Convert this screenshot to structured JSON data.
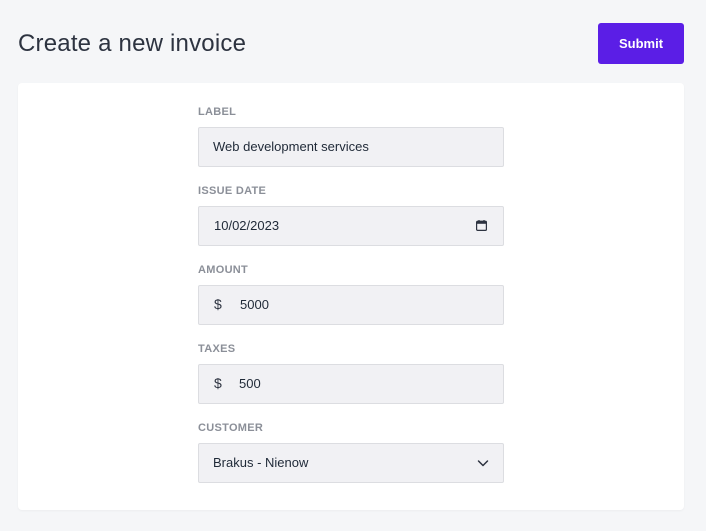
{
  "header": {
    "title": "Create a new invoice",
    "submit_label": "Submit"
  },
  "form": {
    "label": {
      "caption": "LABEL",
      "value": "Web development services"
    },
    "issue_date": {
      "caption": "ISSUE DATE",
      "value": "10/02/2023"
    },
    "amount": {
      "caption": "AMOUNT",
      "currency": "$",
      "value": "5000"
    },
    "taxes": {
      "caption": "TAXES",
      "currency": "$",
      "value": "500"
    },
    "customer": {
      "caption": "CUSTOMER",
      "selected": "Brakus - Nienow"
    }
  },
  "colors": {
    "accent": "#5b1ee6",
    "background": "#f5f6f8",
    "field_background": "#f1f1f4"
  },
  "icons": {
    "calendar": "calendar-icon",
    "dropdown": "chevron-down-icon"
  }
}
